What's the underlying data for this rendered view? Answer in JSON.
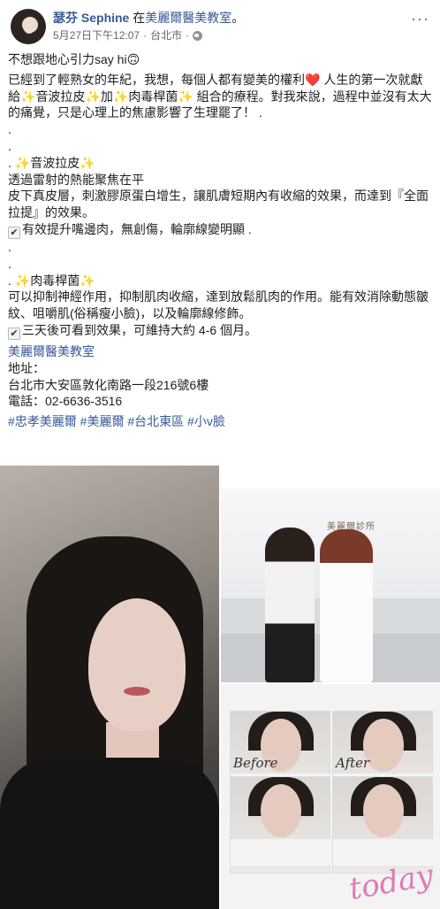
{
  "post": {
    "author": "瑟芬 Sephine",
    "at_text": "在",
    "location_page": "美麗爾醫美教室",
    "location_suffix": "。",
    "date": "5月27日下午12:07",
    "separator": "·",
    "city": "台北市",
    "separator2": "·",
    "privacy_icon": "globe-icon",
    "more_icon": "ellipsis-icon"
  },
  "body": {
    "line_intro": "不想跟地心引力say hi🙃",
    "line_p1a": "已經到了輕熟女的年紀，我想，每個人都有變美的權利",
    "line_p1b": " 人生的第一次就獻給",
    "line_p1c": "音波拉皮",
    "line_p1d": "加",
    "line_p1e": "肉毒桿菌",
    "line_p1f": " 組合的療程。對我來說，過程中並沒有太大的痛覺，只是心理上的焦慮影響了生理罷了！ .",
    "dot1": ".",
    "dot2": ".",
    "sec1_prefix": ". ",
    "sec1_title": "音波拉皮",
    "sec1_l1": "透過雷射的熱能聚焦在平",
    "sec1_l2": "皮下真皮層，刺激膠原蛋白增生，讓肌膚短期內有收縮的效果，而達到『全面拉提』的效果。",
    "sec1_check": "有效提升嘴邊肉，無創傷，輪廓線變明顯 .",
    "dot3": ".",
    "dot4": ".",
    "sec2_prefix": ". ",
    "sec2_title": "肉毒桿菌",
    "sec2_l1": "可以抑制神經作用，抑制肌肉收縮，達到放鬆肌肉的作用。能有效消除動態皺紋、咀嚼肌(俗稱瘦小臉)，以及輪廓線修飾。",
    "sec2_check": "三天後可看到效果，可維持大約 4-6 個月。",
    "clinic_link": "美麗爾醫美教室",
    "address_label": "地址：",
    "address": "台北市大安區敦化南路一段216號6樓",
    "phone": "電話：02-6636-3516",
    "hashtags": "#忠孝美麗爾 #美麗爾 #台北東區 #小v臉",
    "sparkle": "✨",
    "heart": "❤️",
    "check": "✔"
  },
  "photos": {
    "clinic_sign": "美麗爾診所",
    "before": "Before",
    "after": "After",
    "watermark": "today"
  }
}
